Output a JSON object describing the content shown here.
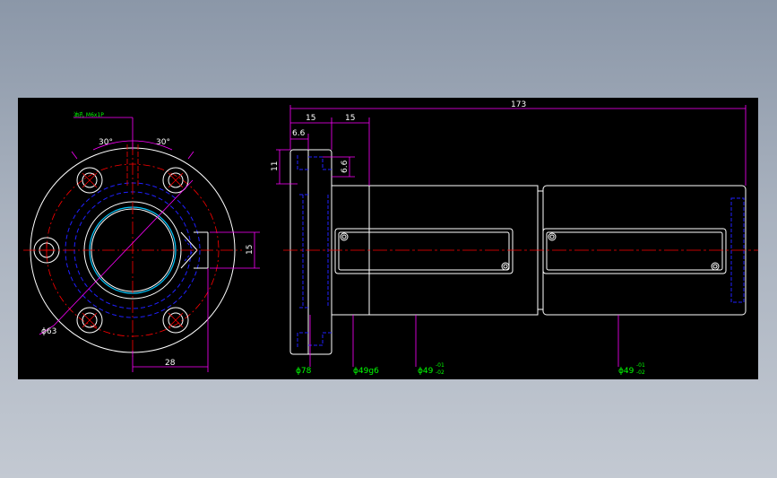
{
  "drawing": {
    "colors": {
      "background": "#000000",
      "outline": "#ffffff",
      "dimension": "#ff00ff",
      "center_line": "#ff0000",
      "hidden_line": "#2020ff",
      "bore_highlight": "#00c8ff",
      "label_text": "#00ff00"
    },
    "front_view": {
      "oil_hole_note": "油孔 M6x1P",
      "angle_left": "30°",
      "angle_right": "30°",
      "bolt_circle_dia": "ϕ63",
      "offset_dim": "28",
      "height_dim": "15"
    },
    "side_view": {
      "total_length": "173",
      "flange_thickness": "15",
      "pilot_length": "15",
      "step_6_6_h": "6.6",
      "step_6_6_v": "6.6",
      "step_11": "11",
      "flange_dia": "ϕ78",
      "pilot_dia": "ϕ49g6",
      "body_dia_1": "ϕ49",
      "body_dia_1_tol_upper": "-01",
      "body_dia_1_tol_lower": "-02",
      "body_dia_2": "ϕ49",
      "body_dia_2_tol_upper": "-01",
      "body_dia_2_tol_lower": "-02"
    }
  }
}
